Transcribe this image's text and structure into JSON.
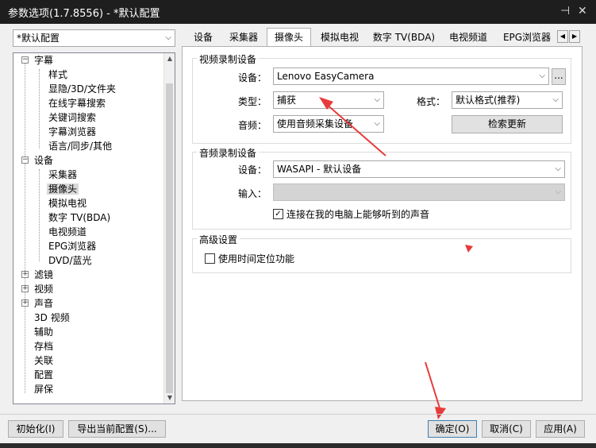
{
  "window": {
    "title": "参数选项(1.7.8556) - *默认配置",
    "pin_icon": "pin-icon",
    "close_icon": "close-icon"
  },
  "profile": {
    "selected": "*默认配置"
  },
  "tree": {
    "items": [
      {
        "label": "字幕",
        "expander": "−"
      },
      {
        "label": "样式"
      },
      {
        "label": "显隐/3D/文件夹"
      },
      {
        "label": "在线字幕搜索"
      },
      {
        "label": "关键词搜索"
      },
      {
        "label": "字幕浏览器"
      },
      {
        "label": "语言/同步/其他"
      },
      {
        "label": "设备",
        "expander": "−"
      },
      {
        "label": "采集器"
      },
      {
        "label": "摄像头"
      },
      {
        "label": "模拟电视"
      },
      {
        "label": "数字 TV(BDA)"
      },
      {
        "label": "电视频道"
      },
      {
        "label": "EPG浏览器"
      },
      {
        "label": "DVD/蓝光"
      },
      {
        "label": "滤镜",
        "expander": "+"
      },
      {
        "label": "视频",
        "expander": "+"
      },
      {
        "label": "声音",
        "expander": "+"
      },
      {
        "label": "3D 视频"
      },
      {
        "label": "辅助"
      },
      {
        "label": "存档"
      },
      {
        "label": "关联"
      },
      {
        "label": "配置"
      },
      {
        "label": "屏保"
      }
    ]
  },
  "tabs": [
    "设备",
    "采集器",
    "摄像头",
    "模拟电视",
    "数字 TV(BDA)",
    "电视频道",
    "EPG浏览器"
  ],
  "video_group": {
    "title": "视频录制设备",
    "device_label": "设备：",
    "device_value": "Lenovo EasyCamera",
    "browse_label": "...",
    "type_label": "类型：",
    "type_value": "捕获",
    "format_label": "格式：",
    "format_value": "默认格式(推荐)",
    "audio_label": "音频：",
    "audio_value": "使用音频采集设备",
    "refresh_label": "检索更新"
  },
  "audio_group": {
    "title": "音频录制设备",
    "device_label": "设备：",
    "device_value": "WASAPI - 默认设备",
    "input_label": "输入：",
    "input_value": "",
    "loopback_label": "连接在我的电脑上能够听到的声音",
    "loopback_checked": true
  },
  "advanced_group": {
    "title": "高级设置",
    "timeshift_label": "使用时间定位功能",
    "timeshift_checked": false
  },
  "footer": {
    "init_label": "初始化(I)",
    "export_label": "导出当前配置(S)...",
    "ok_label": "确定(O)",
    "cancel_label": "取消(C)",
    "apply_label": "应用(A)"
  },
  "colors": {
    "arrow_annotation": "#e83a3a",
    "selected_tab": "#ffffff",
    "tree_selection": "#d9d9d9"
  }
}
